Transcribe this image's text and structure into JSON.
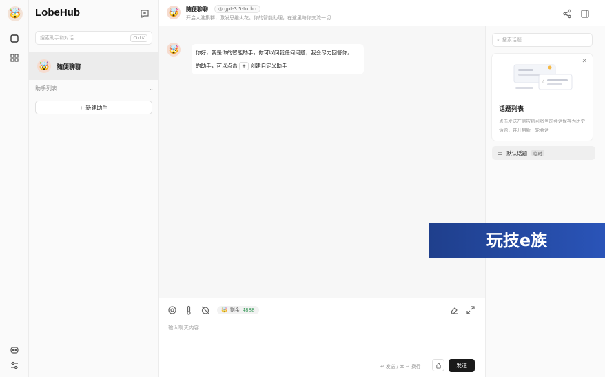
{
  "app": {
    "brand": "LobeHub"
  },
  "sessions": {
    "search_placeholder": "搜索助手和对话...",
    "search_shortcut": "Ctrl K",
    "active_session_title": "随便聊聊",
    "group_label": "助手列表",
    "new_assistant_label": "新建助手"
  },
  "chat": {
    "title": "随便聊聊",
    "model": "gpt-3.5-turbo",
    "description": "开启大脑集群，激发思维火花。你的智能助理，在这里与你交流一切",
    "message": {
      "line1": "你好，我是你的智能助手，你可以问我任何问题，我会尽力回答你。",
      "line2_prefix": "的助手，可以点击",
      "plus_chip": "+",
      "line2_suffix": "创建自定义助手"
    },
    "token_label": "剩余",
    "token_count": "4888",
    "input_placeholder": "输入聊天内容...",
    "send_hint": "↵ 发送 / ⌘ ↵ 换行",
    "send_label": "发送"
  },
  "topics": {
    "search_placeholder": "搜索话题...",
    "card_title": "话题列表",
    "card_desc": "点击发送左侧按钮可将当前会话保存为历史话题，并开启新一轮会话",
    "default_topic": "默认话题",
    "default_topic_tag": "临时"
  },
  "watermark": {
    "text": "玩技e族"
  },
  "colors": {
    "send_button": "#1a1a1a",
    "token_number": "#3a9a5a",
    "watermark_bg": "#2a54b8"
  }
}
